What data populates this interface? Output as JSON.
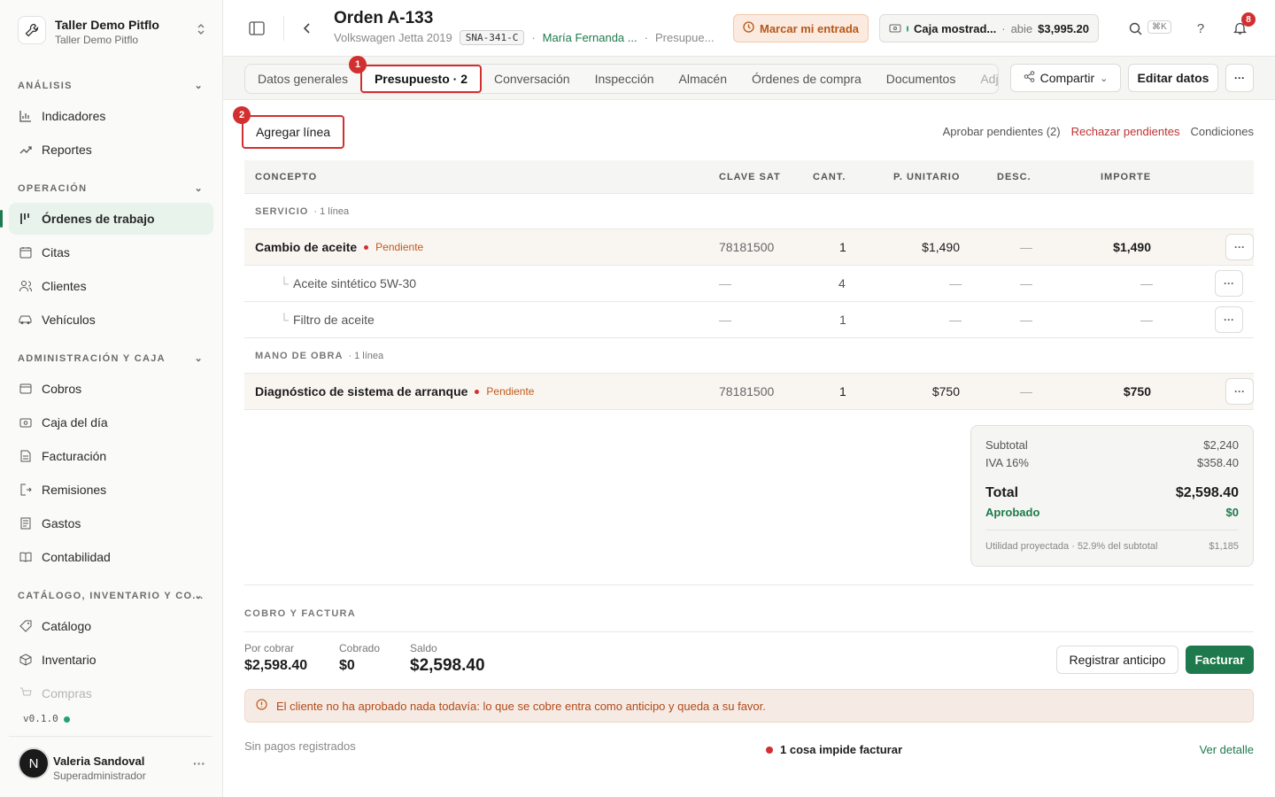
{
  "workspace": {
    "name": "Taller Demo Pitflo",
    "sub": "Taller Demo Pitflo"
  },
  "nav": {
    "sections": [
      {
        "title": "ANÁLISIS",
        "items": [
          {
            "label": "Indicadores",
            "icon": "bar-chart-icon"
          },
          {
            "label": "Reportes",
            "icon": "trend-icon"
          }
        ]
      },
      {
        "title": "OPERACIÓN",
        "items": [
          {
            "label": "Órdenes de trabajo",
            "icon": "kanban-icon",
            "active": true
          },
          {
            "label": "Citas",
            "icon": "calendar-icon"
          },
          {
            "label": "Clientes",
            "icon": "users-icon"
          },
          {
            "label": "Vehículos",
            "icon": "car-icon"
          }
        ]
      },
      {
        "title": "ADMINISTRACIÓN Y CAJA",
        "items": [
          {
            "label": "Cobros",
            "icon": "wallet-icon"
          },
          {
            "label": "Caja del día",
            "icon": "cash-icon"
          },
          {
            "label": "Facturación",
            "icon": "invoice-icon"
          },
          {
            "label": "Remisiones",
            "icon": "export-icon"
          },
          {
            "label": "Gastos",
            "icon": "receipt-icon"
          },
          {
            "label": "Contabilidad",
            "icon": "book-icon"
          }
        ]
      },
      {
        "title": "CATÁLOGO, INVENTARIO Y CO...",
        "items": [
          {
            "label": "Catálogo",
            "icon": "tag-icon"
          },
          {
            "label": "Inventario",
            "icon": "box-icon"
          },
          {
            "label": "Compras",
            "icon": "cart-icon"
          }
        ]
      }
    ],
    "version": "v0.1.0"
  },
  "user": {
    "initial": "N",
    "name": "Valeria Sandoval",
    "role": "Superadministrador"
  },
  "order": {
    "title": "Orden A-133",
    "vehicle": "Volkswagen Jetta 2019",
    "plate": "SNA-341-C",
    "client": "María Fernanda ...",
    "stage": "Presupue..."
  },
  "header": {
    "entrada": "Marcar mi entrada",
    "caja_name": "Caja mostrad...",
    "caja_status": "abie",
    "caja_amount": "$3,995.20",
    "kbd": "⌘K",
    "help": "?",
    "notif_count": "8"
  },
  "tabs": [
    "Datos generales",
    "Presupuesto · 2",
    "Conversación",
    "Inspección",
    "Almacén",
    "Órdenes de compra",
    "Documentos",
    "Adjun"
  ],
  "actions": {
    "share": "Compartir",
    "edit": "Editar datos",
    "more": "···"
  },
  "markers": [
    "1",
    "2"
  ],
  "toolbar": {
    "add_line": "Agregar línea",
    "approve": "Aprobar pendientes (2)",
    "reject": "Rechazar pendientes",
    "conditions": "Condiciones"
  },
  "table": {
    "headers": [
      "CONCEPTO",
      "CLAVE SAT",
      "CANT.",
      "P. UNITARIO",
      "DESC.",
      "IMPORTE"
    ],
    "groups": [
      {
        "name": "SERVICIO",
        "count": "· 1 línea",
        "rows": [
          {
            "concept": "Cambio de aceite",
            "status": "Pendiente",
            "sat": "78181500",
            "qty": "1",
            "price": "$1,490",
            "desc": "—",
            "amount": "$1,490",
            "main": true
          },
          {
            "concept": "Aceite sintético 5W-30",
            "sat": "—",
            "qty": "4",
            "price": "—",
            "desc": "—",
            "amount": "—"
          },
          {
            "concept": "Filtro de aceite",
            "sat": "—",
            "qty": "1",
            "price": "—",
            "desc": "—",
            "amount": "—"
          }
        ]
      },
      {
        "name": "MANO DE OBRA",
        "count": "· 1 línea",
        "rows": [
          {
            "concept": "Diagnóstico de sistema de arranque",
            "status": "Pendiente",
            "sat": "78181500",
            "qty": "1",
            "price": "$750",
            "desc": "—",
            "amount": "$750",
            "main": true
          }
        ]
      }
    ]
  },
  "totals": {
    "subtotal_label": "Subtotal",
    "subtotal": "$2,240",
    "iva_label": "IVA 16%",
    "iva": "$358.40",
    "total_label": "Total",
    "total": "$2,598.40",
    "approved_label": "Aprobado",
    "approved": "$0",
    "util_label": "Utilidad proyectada · 52.9% del subtotal",
    "util": "$1,185"
  },
  "billing": {
    "section": "COBRO Y FACTURA",
    "por_cobrar_label": "Por cobrar",
    "por_cobrar": "$2,598.40",
    "cobrado_label": "Cobrado",
    "cobrado": "$0",
    "saldo_label": "Saldo",
    "saldo": "$2,598.40",
    "anticipo": "Registrar anticipo",
    "facturar": "Facturar",
    "alert": "El cliente no ha aprobado nada todavía: lo que se cobre entra como anticipo y queda a su favor.",
    "no_payments": "Sin pagos registrados",
    "blocker": "1 cosa impide facturar",
    "detail": "Ver detalle"
  },
  "colors": {
    "accent": "#1e7a4c",
    "danger": "#d23030",
    "warning": "#c05a1a"
  }
}
